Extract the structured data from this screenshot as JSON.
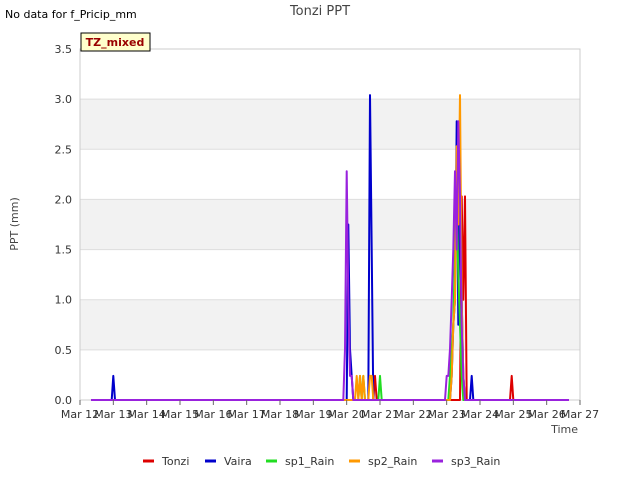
{
  "header": {
    "no_data_note": "No data for f_Pricip_mm",
    "badge": "TZ_mixed"
  },
  "colors": {
    "Tonzi": "#dd0000",
    "Vaira": "#0000cc",
    "sp1_Rain": "#22dd22",
    "sp2_Rain": "#ff9900",
    "sp3_Rain": "#9922dd",
    "band": "#f2f2f2",
    "badge_bg": "#ffffcc",
    "badge_text": "#990000"
  },
  "chart_data": {
    "type": "line",
    "title": "Tonzi PPT",
    "xlabel": "Time",
    "ylabel": "PPT (mm)",
    "xlim": [
      12,
      27
    ],
    "ylim": [
      0,
      3.5
    ],
    "x_ticks": [
      12,
      13,
      14,
      15,
      16,
      17,
      18,
      19,
      20,
      21,
      22,
      23,
      24,
      25,
      26,
      27
    ],
    "x_tick_labels": [
      "Mar 12",
      "Mar 13",
      "Mar 14",
      "Mar 15",
      "Mar 16",
      "Mar 17",
      "Mar 18",
      "Mar 19",
      "Mar 20",
      "Mar 21",
      "Mar 22",
      "Mar 23",
      "Mar 24",
      "Mar 25",
      "Mar 26",
      "Mar 27"
    ],
    "y_ticks": [
      0,
      0.5,
      1.0,
      1.5,
      2.0,
      2.5,
      3.0,
      3.5
    ],
    "y_tick_labels": [
      "0.0",
      "0.5",
      "1.0",
      "1.5",
      "2.0",
      "2.5",
      "3.0",
      "3.5"
    ],
    "grid": true,
    "legend_position": "bottom",
    "series": [
      {
        "name": "Tonzi",
        "x": [
          12.33,
          20.8,
          20.85,
          20.9,
          23.4,
          23.45,
          23.5,
          23.55,
          23.6,
          24.9,
          24.95,
          25.0,
          26.67
        ],
        "y": [
          0,
          0,
          0.24,
          0,
          0,
          2.03,
          1.0,
          2.03,
          0,
          0,
          0.24,
          0,
          0
        ]
      },
      {
        "name": "Vaira",
        "x": [
          12.33,
          12.95,
          13.0,
          13.05,
          20.0,
          20.05,
          20.1,
          20.15,
          20.2,
          20.65,
          20.7,
          20.75,
          20.8,
          23.1,
          23.15,
          23.2,
          23.25,
          23.3,
          23.35,
          23.4,
          23.45,
          23.5,
          23.55,
          23.6,
          23.7,
          23.75,
          23.8,
          23.85,
          23.9,
          24.0,
          26.67
        ],
        "y": [
          0,
          0,
          0.24,
          0,
          0,
          1.75,
          0.51,
          0.24,
          0,
          0,
          3.04,
          1.5,
          0,
          0,
          0.24,
          0.75,
          1.0,
          2.78,
          0.75,
          2.53,
          1.0,
          0.24,
          0,
          0,
          0,
          0.24,
          0,
          0,
          0,
          0,
          0
        ]
      },
      {
        "name": "sp1_Rain",
        "x": [
          12.33,
          20.35,
          20.4,
          20.45,
          20.5,
          20.55,
          20.95,
          21.0,
          21.05,
          23.05,
          23.1,
          23.15,
          23.2,
          23.25,
          23.3,
          23.35,
          23.4,
          23.45,
          23.5,
          23.55,
          23.6,
          26.67
        ],
        "y": [
          0,
          0,
          0.24,
          0,
          0.24,
          0,
          0,
          0.24,
          0,
          0,
          0.24,
          0.51,
          0.75,
          1.5,
          2.0,
          1.25,
          0.75,
          0.24,
          0,
          0,
          0,
          0
        ]
      },
      {
        "name": "sp2_Rain",
        "x": [
          12.33,
          20.25,
          20.3,
          20.35,
          20.4,
          20.45,
          20.5,
          20.55,
          20.6,
          20.65,
          20.7,
          20.75,
          20.8,
          23.1,
          23.15,
          23.2,
          23.25,
          23.3,
          23.35,
          23.4,
          23.45,
          23.5,
          23.55,
          23.6,
          26.67
        ],
        "y": [
          0,
          0,
          0.24,
          0,
          0.24,
          0,
          0.24,
          0,
          0,
          0,
          0.24,
          0.24,
          0,
          0,
          0.24,
          0.75,
          1.0,
          2.53,
          1.75,
          3.04,
          1.0,
          0.24,
          0,
          0,
          0
        ]
      },
      {
        "name": "sp3_Rain",
        "x": [
          12.33,
          19.9,
          19.95,
          20.0,
          20.05,
          20.1,
          20.15,
          20.2,
          20.25,
          20.3,
          22.95,
          23.0,
          23.05,
          23.1,
          23.15,
          23.2,
          23.25,
          23.3,
          23.35,
          23.4,
          23.45,
          23.5,
          23.55,
          23.6,
          23.65,
          24.0,
          26.67
        ],
        "y": [
          0,
          0,
          0.51,
          2.28,
          1.0,
          0.24,
          0.24,
          0,
          0,
          0,
          0,
          0.24,
          0.24,
          0.51,
          1.0,
          1.5,
          2.28,
          1.5,
          2.78,
          2.03,
          0.75,
          0.24,
          0,
          0,
          0,
          0,
          0
        ]
      }
    ]
  }
}
